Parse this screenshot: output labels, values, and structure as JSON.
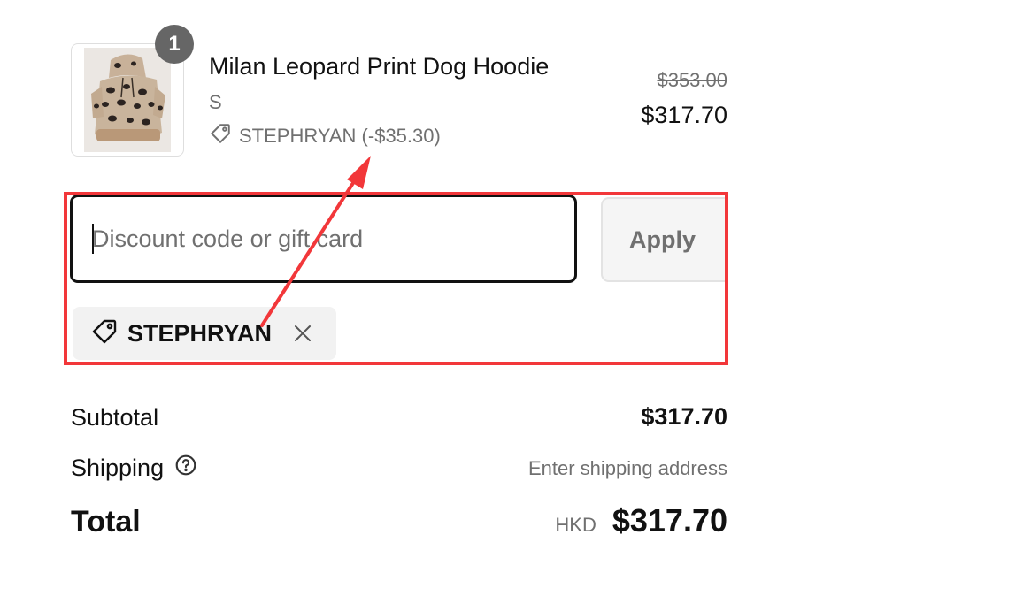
{
  "line_item": {
    "quantity": "1",
    "name": "Milan Leopard Print Dog Hoodie",
    "variant": "S",
    "discount_text": "STEPHRYAN (-$35.30)",
    "compare_price": "$353.00",
    "price": "$317.70",
    "image_icon": "leopard-hoodie-image"
  },
  "discount": {
    "placeholder": "Discount code or gift card",
    "value": "",
    "apply_label": "Apply",
    "applied_code": "STEPHRYAN"
  },
  "totals": {
    "subtotal_label": "Subtotal",
    "subtotal_value": "$317.70",
    "shipping_label": "Shipping",
    "shipping_value": "Enter shipping address",
    "total_label": "Total",
    "currency": "HKD",
    "total_value": "$317.70"
  },
  "colors": {
    "annotation_red": "#f2373a",
    "muted_text": "#707070",
    "badge_bg": "#666666",
    "chip_bg": "#f2f2f2"
  }
}
